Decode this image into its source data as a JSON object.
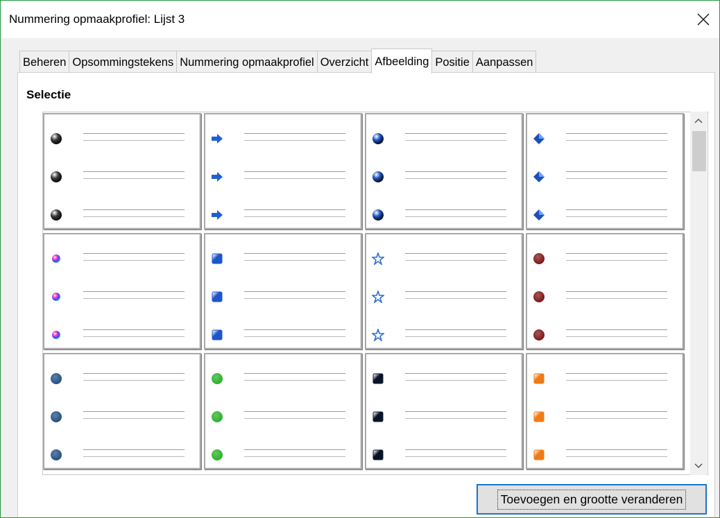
{
  "window": {
    "title": "Nummering opmaakprofiel: Lijst 3",
    "close_icon": "close-icon"
  },
  "tabs": [
    {
      "label": "Beheren",
      "active": false
    },
    {
      "label": "Opsommingstekens",
      "active": false
    },
    {
      "label": "Nummering opmaakprofiel",
      "active": false
    },
    {
      "label": "Overzicht",
      "active": false
    },
    {
      "label": "Afbeelding",
      "active": true
    },
    {
      "label": "Positie",
      "active": false
    },
    {
      "label": "Aanpassen",
      "active": false
    }
  ],
  "selection": {
    "label": "Selectie",
    "grid": [
      [
        {
          "icon": "gray-sphere-bullet-icon",
          "color": "#3a3a3a"
        },
        {
          "icon": "blue-arrow-bullet-icon",
          "color": "#1e5fd6"
        },
        {
          "icon": "blue-sphere-bullet-icon",
          "color": "#1c56c8"
        },
        {
          "icon": "blue-diamond-bullet-icon",
          "color": "#1c4fb8"
        }
      ],
      [
        {
          "icon": "rainbow-sphere-bullet-icon",
          "color": "#c03ad8"
        },
        {
          "icon": "blue-square-bullet-icon",
          "color": "#1c56c8"
        },
        {
          "icon": "blue-star-bullet-icon",
          "color": "#2f6fd0"
        },
        {
          "icon": "darkred-circle-bullet-icon",
          "color": "#7a0f0f"
        }
      ],
      [
        {
          "icon": "navy-circle-bullet-icon",
          "color": "#1b4a80"
        },
        {
          "icon": "green-circle-bullet-icon",
          "color": "#22b022"
        },
        {
          "icon": "black-square-bullet-icon",
          "color": "#0a1428"
        },
        {
          "icon": "orange-square-bullet-icon",
          "color": "#f07a14"
        }
      ]
    ]
  },
  "scrollbar": {
    "up_icon": "chevron-up-icon",
    "down_icon": "chevron-down-icon"
  },
  "actions": {
    "add_resize_label": "Toevoegen en grootte veranderen"
  }
}
